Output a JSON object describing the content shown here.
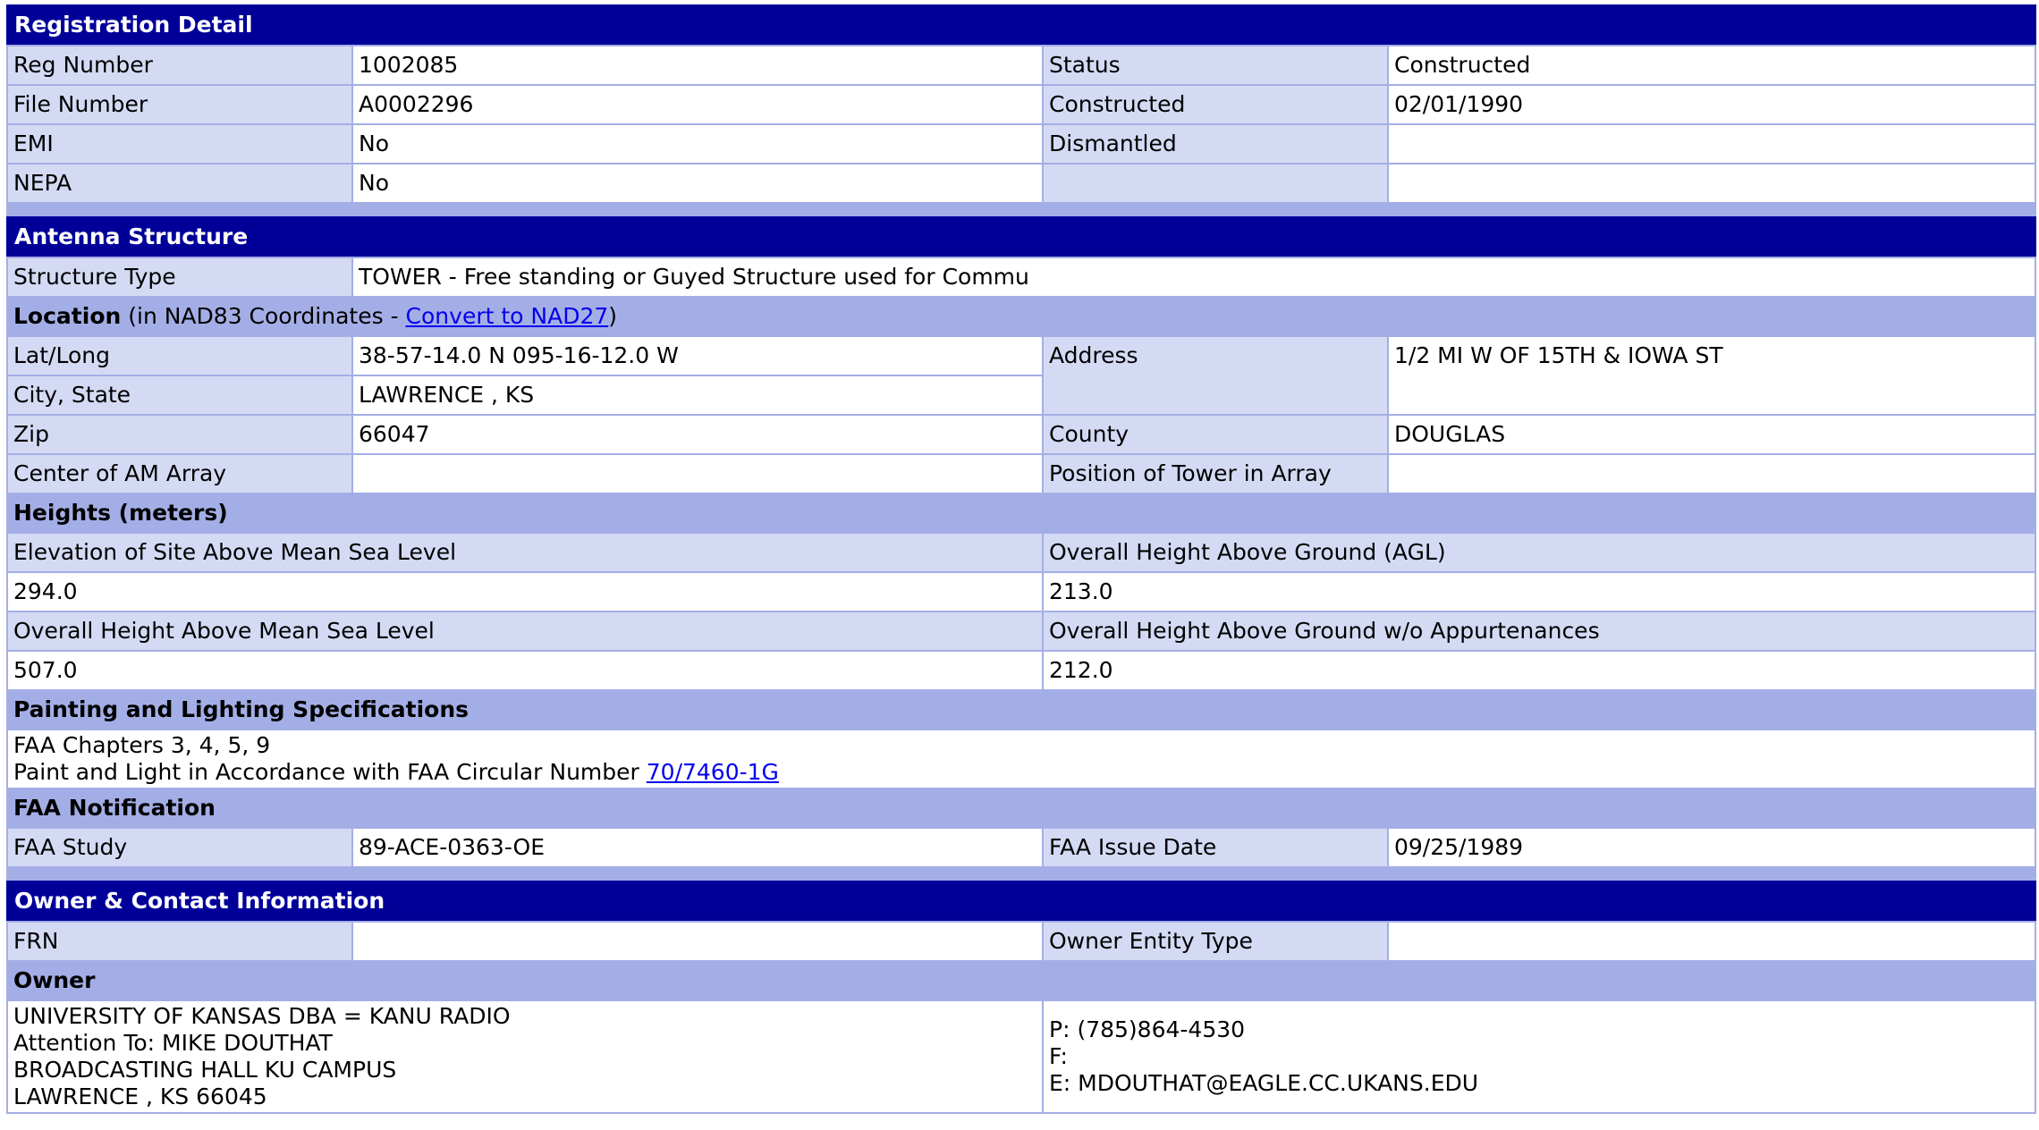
{
  "registration": {
    "title": "Registration Detail",
    "reg_number_label": "Reg Number",
    "reg_number": "1002085",
    "status_label": "Status",
    "status": "Constructed",
    "file_number_label": "File Number",
    "file_number": "A0002296",
    "constructed_label": "Constructed",
    "constructed": "02/01/1990",
    "emi_label": "EMI",
    "emi": "No",
    "dismantled_label": "Dismantled",
    "dismantled": "",
    "nepa_label": "NEPA",
    "nepa": "No"
  },
  "antenna": {
    "title": "Antenna Structure",
    "structure_type_label": "Structure Type",
    "structure_type": "TOWER - Free standing or Guyed Structure used for Commu",
    "location_label": "Location",
    "location_note_prefix": " (in NAD83 Coordinates - ",
    "location_link": "Convert to NAD27",
    "location_note_suffix": ")",
    "latlong_label": "Lat/Long",
    "latlong": "38-57-14.0 N 095-16-12.0 W",
    "address_label": "Address",
    "address": "1/2 MI W OF 15TH & IOWA ST",
    "city_state_label": "City, State",
    "city_state": "LAWRENCE , KS",
    "zip_label": "Zip",
    "zip": "66047",
    "county_label": "County",
    "county": "DOUGLAS",
    "am_array_label": "Center of AM Array",
    "am_array": "",
    "position_label": "Position of Tower in Array",
    "position": ""
  },
  "heights": {
    "title": "Heights (meters)",
    "elevation_label": "Elevation of Site Above Mean Sea Level",
    "agl_label": "Overall Height Above Ground (AGL)",
    "elevation": "294.0",
    "agl": "213.0",
    "amsl_label": "Overall Height Above Mean Sea Level",
    "agl_wo_label": "Overall Height Above Ground w/o Appurtenances",
    "amsl": "507.0",
    "agl_wo": "212.0"
  },
  "painting": {
    "title": "Painting and Lighting Specifications",
    "chapters": "FAA Chapters 3, 4, 5, 9",
    "paint_text": "Paint and Light in Accordance with FAA Circular Number ",
    "circular_link": "70/7460-1G"
  },
  "faa": {
    "title": "FAA Notification",
    "study_label": "FAA Study",
    "study": "89-ACE-0363-OE",
    "issue_date_label": "FAA Issue Date",
    "issue_date": "09/25/1989"
  },
  "owner_contact": {
    "title": "Owner & Contact Information",
    "frn_label": "FRN",
    "frn": "",
    "entity_type_label": "Owner Entity Type",
    "entity_type": "",
    "owner_label": "Owner",
    "owner_lines": [
      "UNIVERSITY OF KANSAS DBA = KANU RADIO",
      "Attention To: MIKE DOUTHAT",
      "BROADCASTING HALL KU CAMPUS",
      "LAWRENCE , KS 66045"
    ],
    "contact_lines": [
      "P: (785)864-4530",
      "F:",
      "E: MDOUTHAT@EAGLE.CC.UKANS.EDU"
    ]
  }
}
